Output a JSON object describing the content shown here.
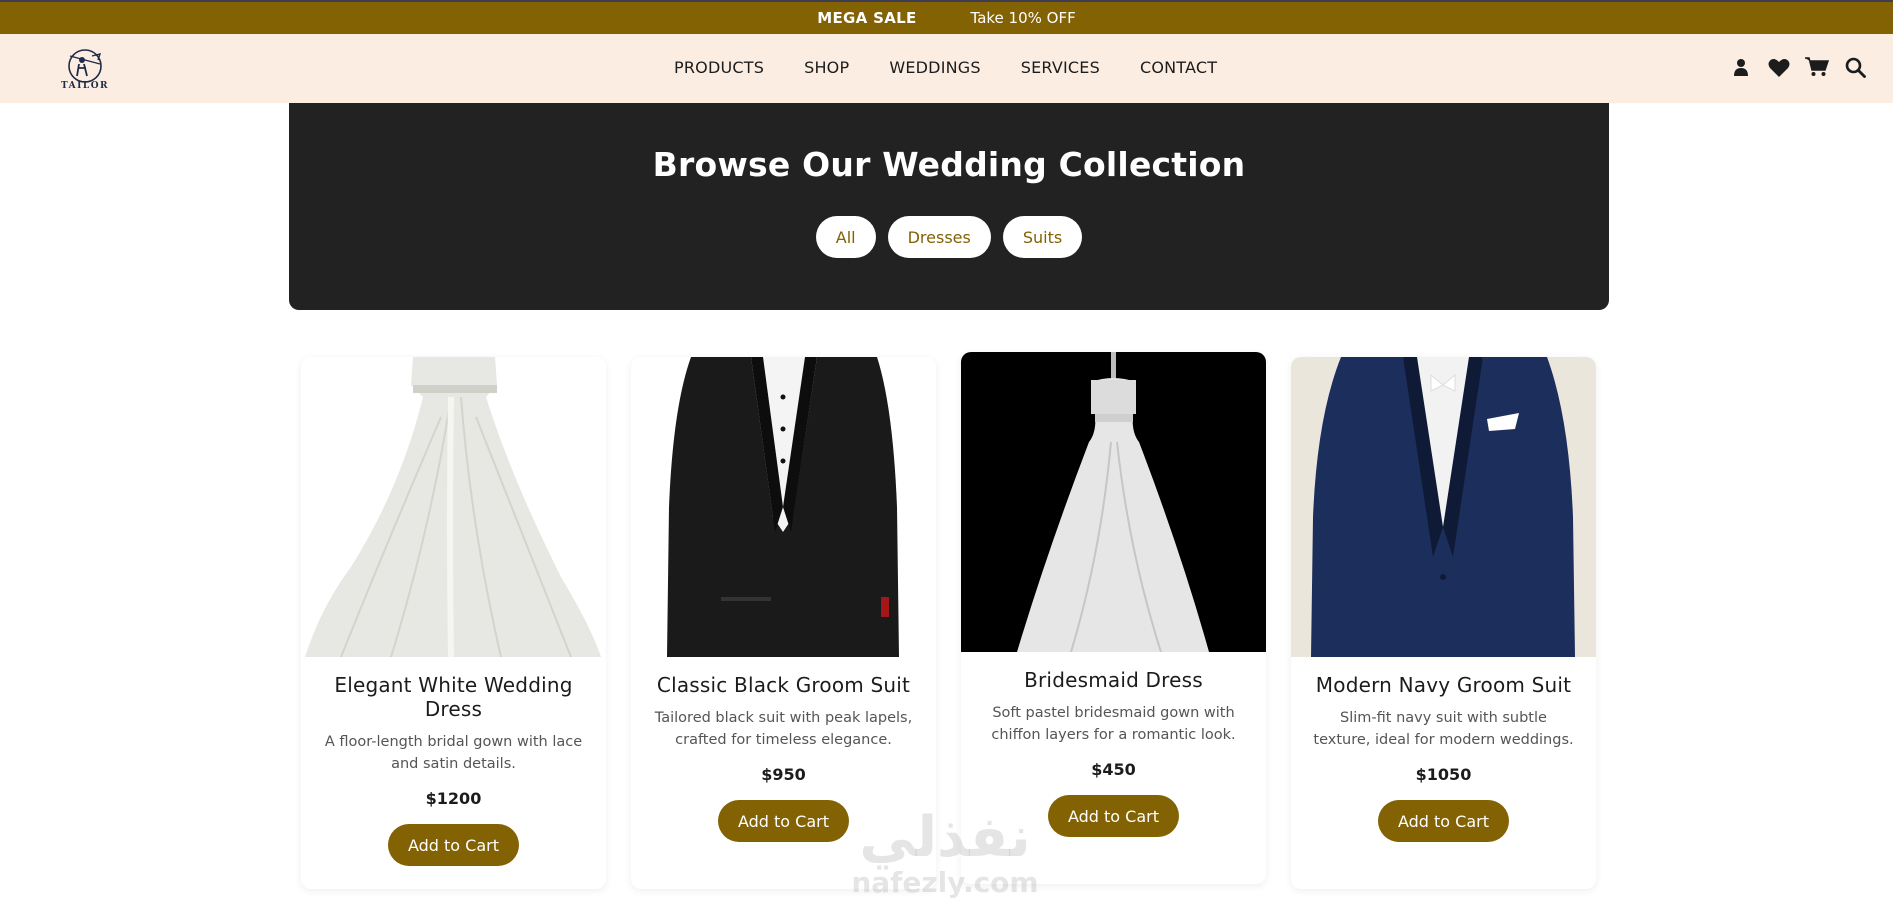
{
  "promo": {
    "mega_sale": "MEGA SALE",
    "offer": "Take 10% OFF"
  },
  "brand": {
    "logo_text": "TAILOR"
  },
  "nav": {
    "links": [
      "PRODUCTS",
      "SHOP",
      "WEDDINGS",
      "SERVICES",
      "CONTACT"
    ],
    "icons": [
      "user-icon",
      "heart-icon",
      "cart-icon",
      "search-icon"
    ]
  },
  "hero": {
    "title": "Browse Our Wedding Collection",
    "filters": [
      "All",
      "Dresses",
      "Suits"
    ]
  },
  "products": [
    {
      "title": "Elegant White Wedding Dress",
      "description": "A floor-length bridal gown with lace and satin details.",
      "price": "$1200",
      "button": "Add to Cart",
      "image": "white-wedding-dress-image"
    },
    {
      "title": "Classic Black Groom Suit",
      "description": "Tailored black suit with peak lapels, crafted for timeless elegance.",
      "price": "$950",
      "button": "Add to Cart",
      "image": "black-groom-suit-image"
    },
    {
      "title": "Bridesmaid Dress",
      "description": "Soft pastel bridesmaid gown with chiffon layers for a romantic look.",
      "price": "$450",
      "button": "Add to Cart",
      "image": "bridesmaid-dress-image"
    },
    {
      "title": "Modern Navy Groom Suit",
      "description": "Slim-fit navy suit with subtle texture, ideal for modern weddings.",
      "price": "$1050",
      "button": "Add to Cart",
      "image": "navy-groom-suit-image"
    }
  ],
  "watermark": {
    "arabic": "نفذلي",
    "latin": "nafezly.com"
  },
  "colors": {
    "brand_gold": "#826203",
    "nav_background": "#fbede2",
    "hero_background": "#222222"
  }
}
